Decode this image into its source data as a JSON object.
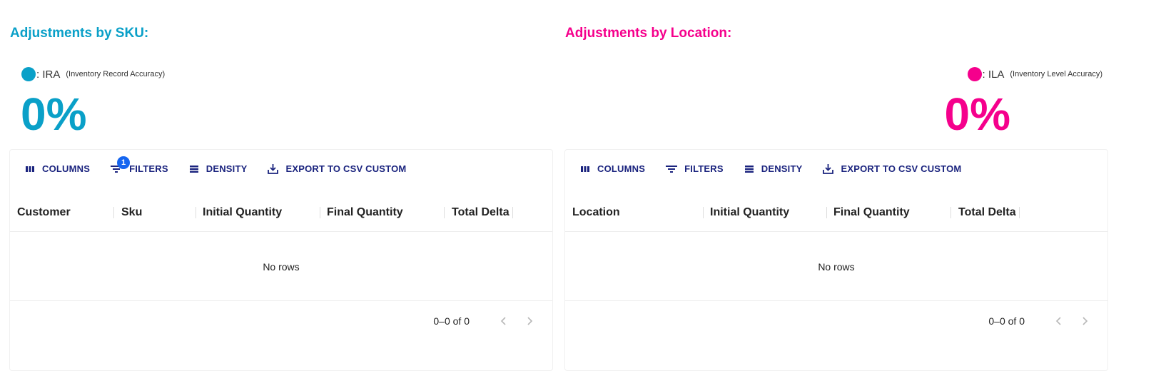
{
  "colors": {
    "ira": "#0aa0c8",
    "ila": "#f5008c",
    "toolbar": "#1a237e",
    "badge": "#1565f0"
  },
  "left": {
    "title": "Adjustments by SKU:",
    "legend": {
      "label": ": IRA",
      "sub": "(Inventory Record Accuracy)"
    },
    "value": "0%",
    "toolbar": {
      "columns": "COLUMNS",
      "filters": "FILTERS",
      "filters_badge": "1",
      "density": "DENSITY",
      "export": "EXPORT TO CSV CUSTOM"
    },
    "columns": [
      "Customer",
      "Sku",
      "Initial Quantity",
      "Final Quantity",
      "Total Delta"
    ],
    "empty": "No rows",
    "pagination": "0–0 of 0"
  },
  "right": {
    "title": "Adjustments by Location:",
    "legend": {
      "label": ": ILA",
      "sub": "(Inventory Level Accuracy)"
    },
    "value": "0%",
    "toolbar": {
      "columns": "COLUMNS",
      "filters": "FILTERS",
      "density": "DENSITY",
      "export": "EXPORT TO CSV CUSTOM"
    },
    "columns": [
      "Location",
      "Initial Quantity",
      "Final Quantity",
      "Total Delta"
    ],
    "empty": "No rows",
    "pagination": "0–0 of 0"
  }
}
